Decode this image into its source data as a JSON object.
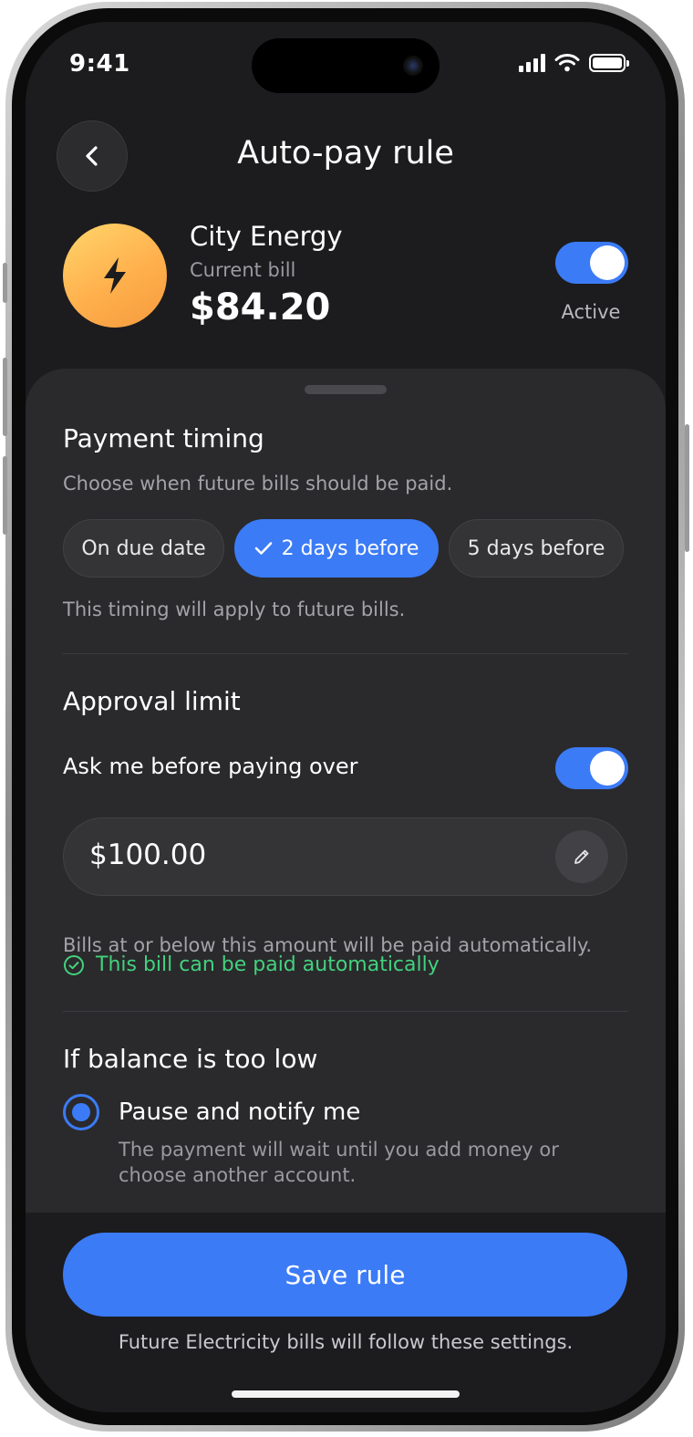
{
  "status_bar": {
    "time": "9:41"
  },
  "header": {
    "title": "Auto-pay rule"
  },
  "biller": {
    "name": "City Energy",
    "subtitle": "Current bill",
    "amount": "$84.20",
    "status_label": "Active",
    "active": true,
    "logo_icon": "lightning-bolt-icon"
  },
  "payment_timing": {
    "title": "Payment timing",
    "subtitle": "Choose when future bills should be paid.",
    "options": [
      "On due date",
      "2 days before",
      "5 days before"
    ],
    "selected": "2 days before",
    "note": "This timing will apply to future bills."
  },
  "approval_limit": {
    "title": "Approval limit",
    "toggle_label": "Ask me before paying over",
    "enabled": true,
    "amount": "$100.00",
    "note": "Bills at or below this amount will be paid automatically.",
    "status": "This bill can be paid automatically"
  },
  "low_balance": {
    "title": "If balance is too low",
    "option_title": "Pause and notify me",
    "option_desc": "The payment will wait until you add money or choose another account."
  },
  "footer": {
    "save_label": "Save rule",
    "note": "Future Electricity bills will follow these settings."
  },
  "colors": {
    "accent": "#3b7bf6",
    "success": "#43d17e",
    "background": "#1c1c1e",
    "sheet": "#2a2a2c"
  }
}
